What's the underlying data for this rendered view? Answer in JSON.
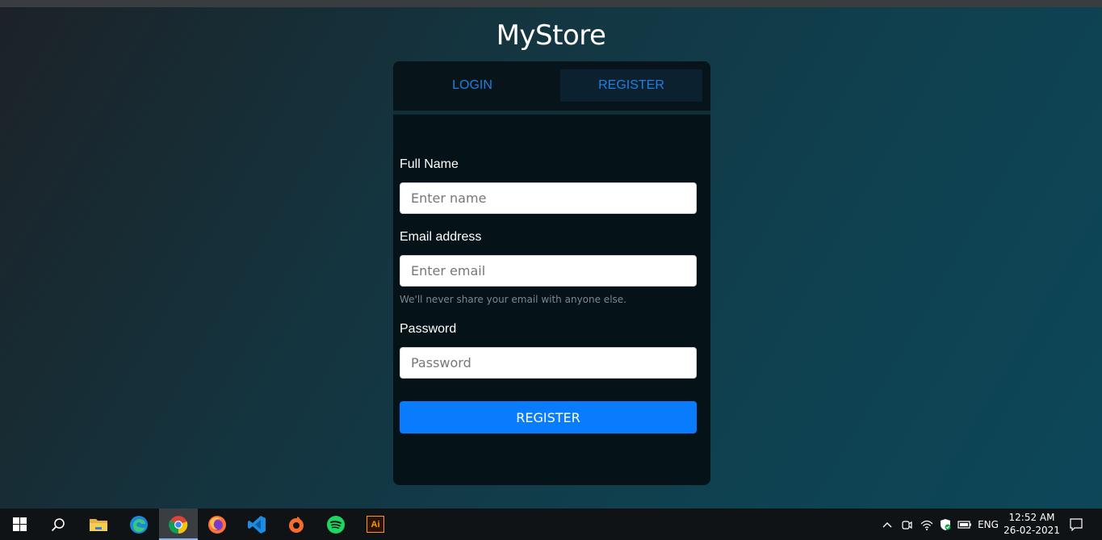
{
  "app": {
    "brand": "MyStore"
  },
  "tabs": {
    "login": "LOGIN",
    "register": "REGISTER"
  },
  "form": {
    "fullname_label": "Full Name",
    "fullname_placeholder": "Enter name",
    "email_label": "Email address",
    "email_placeholder": "Enter email",
    "email_hint": "We'll never share your email with anyone else.",
    "password_label": "Password",
    "password_placeholder": "Password",
    "submit_label": "REGISTER"
  },
  "colors": {
    "accent": "#087cfd",
    "tab_text": "#1f7fe0",
    "card_bg": "#051217"
  },
  "taskbar": {
    "apps": [
      "windows-start-icon",
      "search-icon",
      "file-explorer-icon",
      "edge-icon",
      "chrome-icon",
      "firefox-icon",
      "vscode-icon",
      "origin-icon",
      "spotify-icon",
      "illustrator-icon"
    ],
    "illustrator_label": "Ai",
    "language": "ENG",
    "time": "12:52 AM",
    "date": "26-02-2021"
  }
}
